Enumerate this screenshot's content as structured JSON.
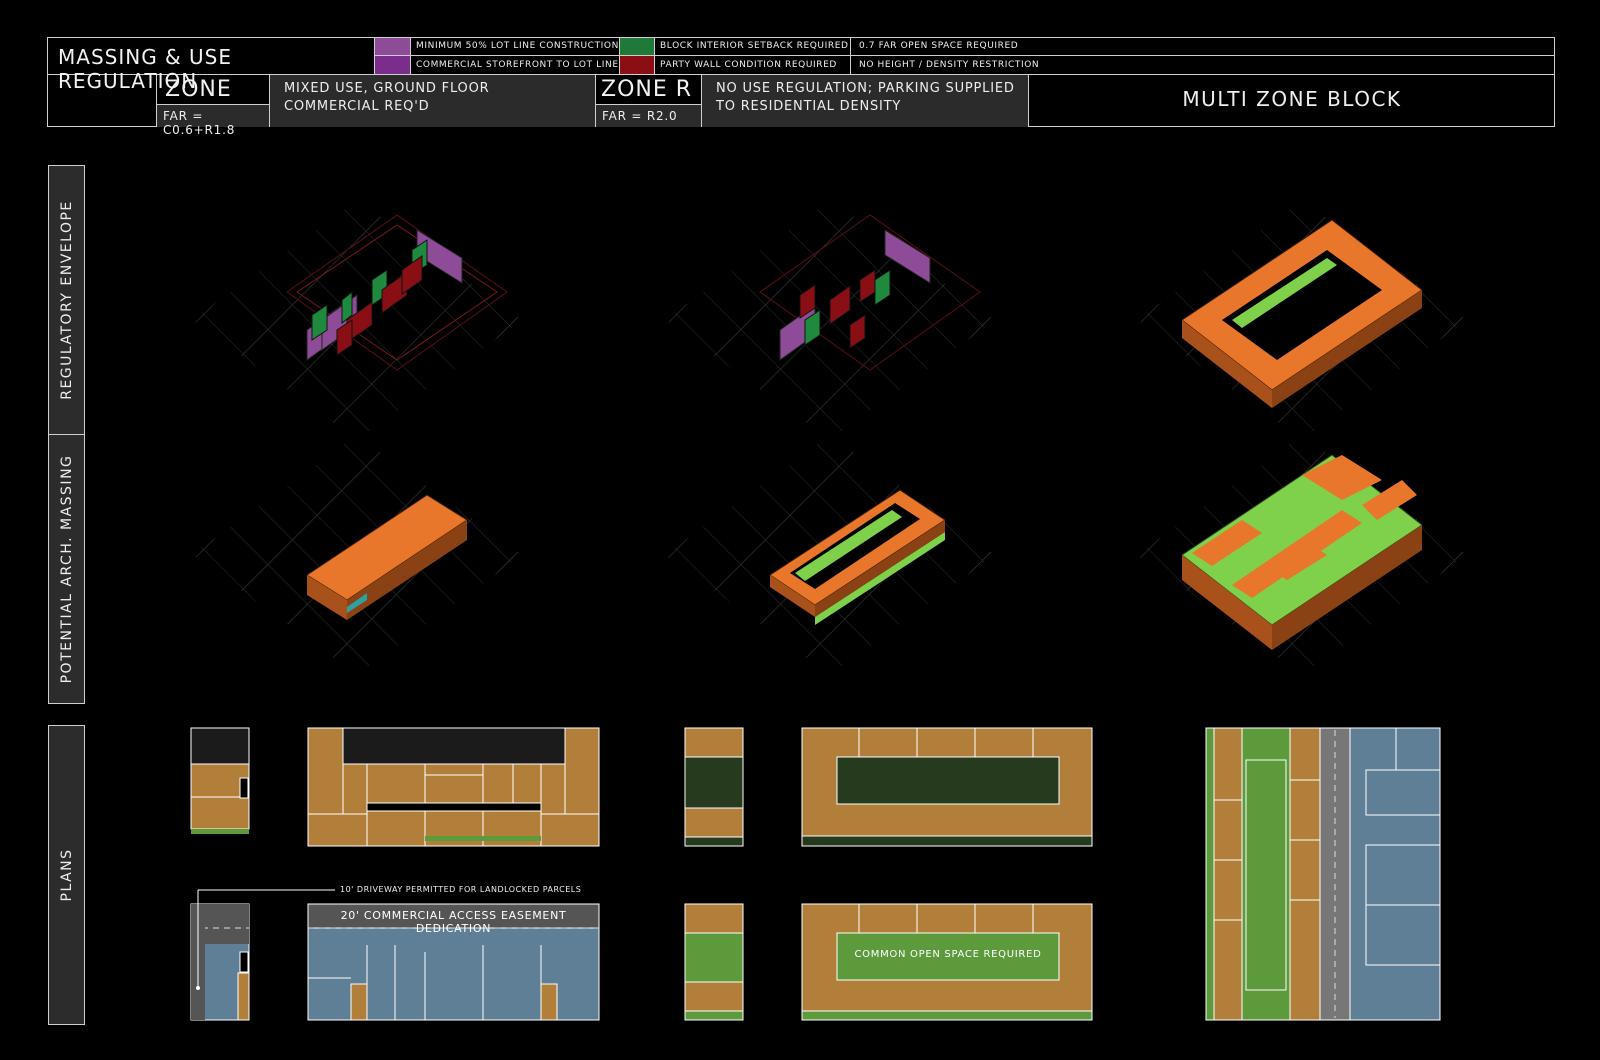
{
  "header": {
    "title": "MASSING & USE REGULATION",
    "legend": [
      {
        "label": "MINIMUM 50% LOT LINE CONSTRUCTION",
        "color": "#8e4b98"
      },
      {
        "label": "COMMERCIAL STOREFRONT TO LOT LINE",
        "color": "#7b2d8e"
      },
      {
        "label": "BLOCK INTERIOR SETBACK REQUIRED",
        "color": "#1f7a3a"
      },
      {
        "label": "PARTY WALL CONDITION REQUIRED",
        "color": "#8a0f14"
      },
      {
        "label": "0.7 FAR OPEN SPACE REQUIRED",
        "color": ""
      },
      {
        "label": "NO HEIGHT / DENSITY RESTRICTION",
        "color": ""
      }
    ],
    "zone_mx": {
      "name": "ZONE MX",
      "far": "FAR = C0.6+R1.8",
      "desc1": "MIXED USE, GROUND FLOOR",
      "desc2": "COMMERCIAL REQ'D"
    },
    "zone_r": {
      "name": "ZONE R",
      "far": "FAR = R2.0",
      "desc1": "NO USE REGULATION; PARKING SUPPLIED",
      "desc2": "TO RESIDENTIAL DENSITY"
    },
    "multi": "MULTI ZONE BLOCK"
  },
  "side_labels": {
    "envelope": "REGULATORY ENVELOPE",
    "massing": "POTENTIAL ARCH. MASSING",
    "plans": "PLANS"
  },
  "plan_notes": {
    "driveway": "10' DRIVEWAY PERMITTED FOR LANDLOCKED PARCELS",
    "easement": "20' COMMERCIAL ACCESS EASEMENT DEDICATION",
    "open_space": "COMMON OPEN SPACE REQUIRED"
  },
  "colors": {
    "residential": "#b27f3b",
    "commercial": "#5f7f96",
    "open_space": "#5d9a3c",
    "dark_green": "#263a1d",
    "massing_orange": "#e8772b",
    "massing_green": "#7fd14b",
    "line": "#ffffff"
  }
}
